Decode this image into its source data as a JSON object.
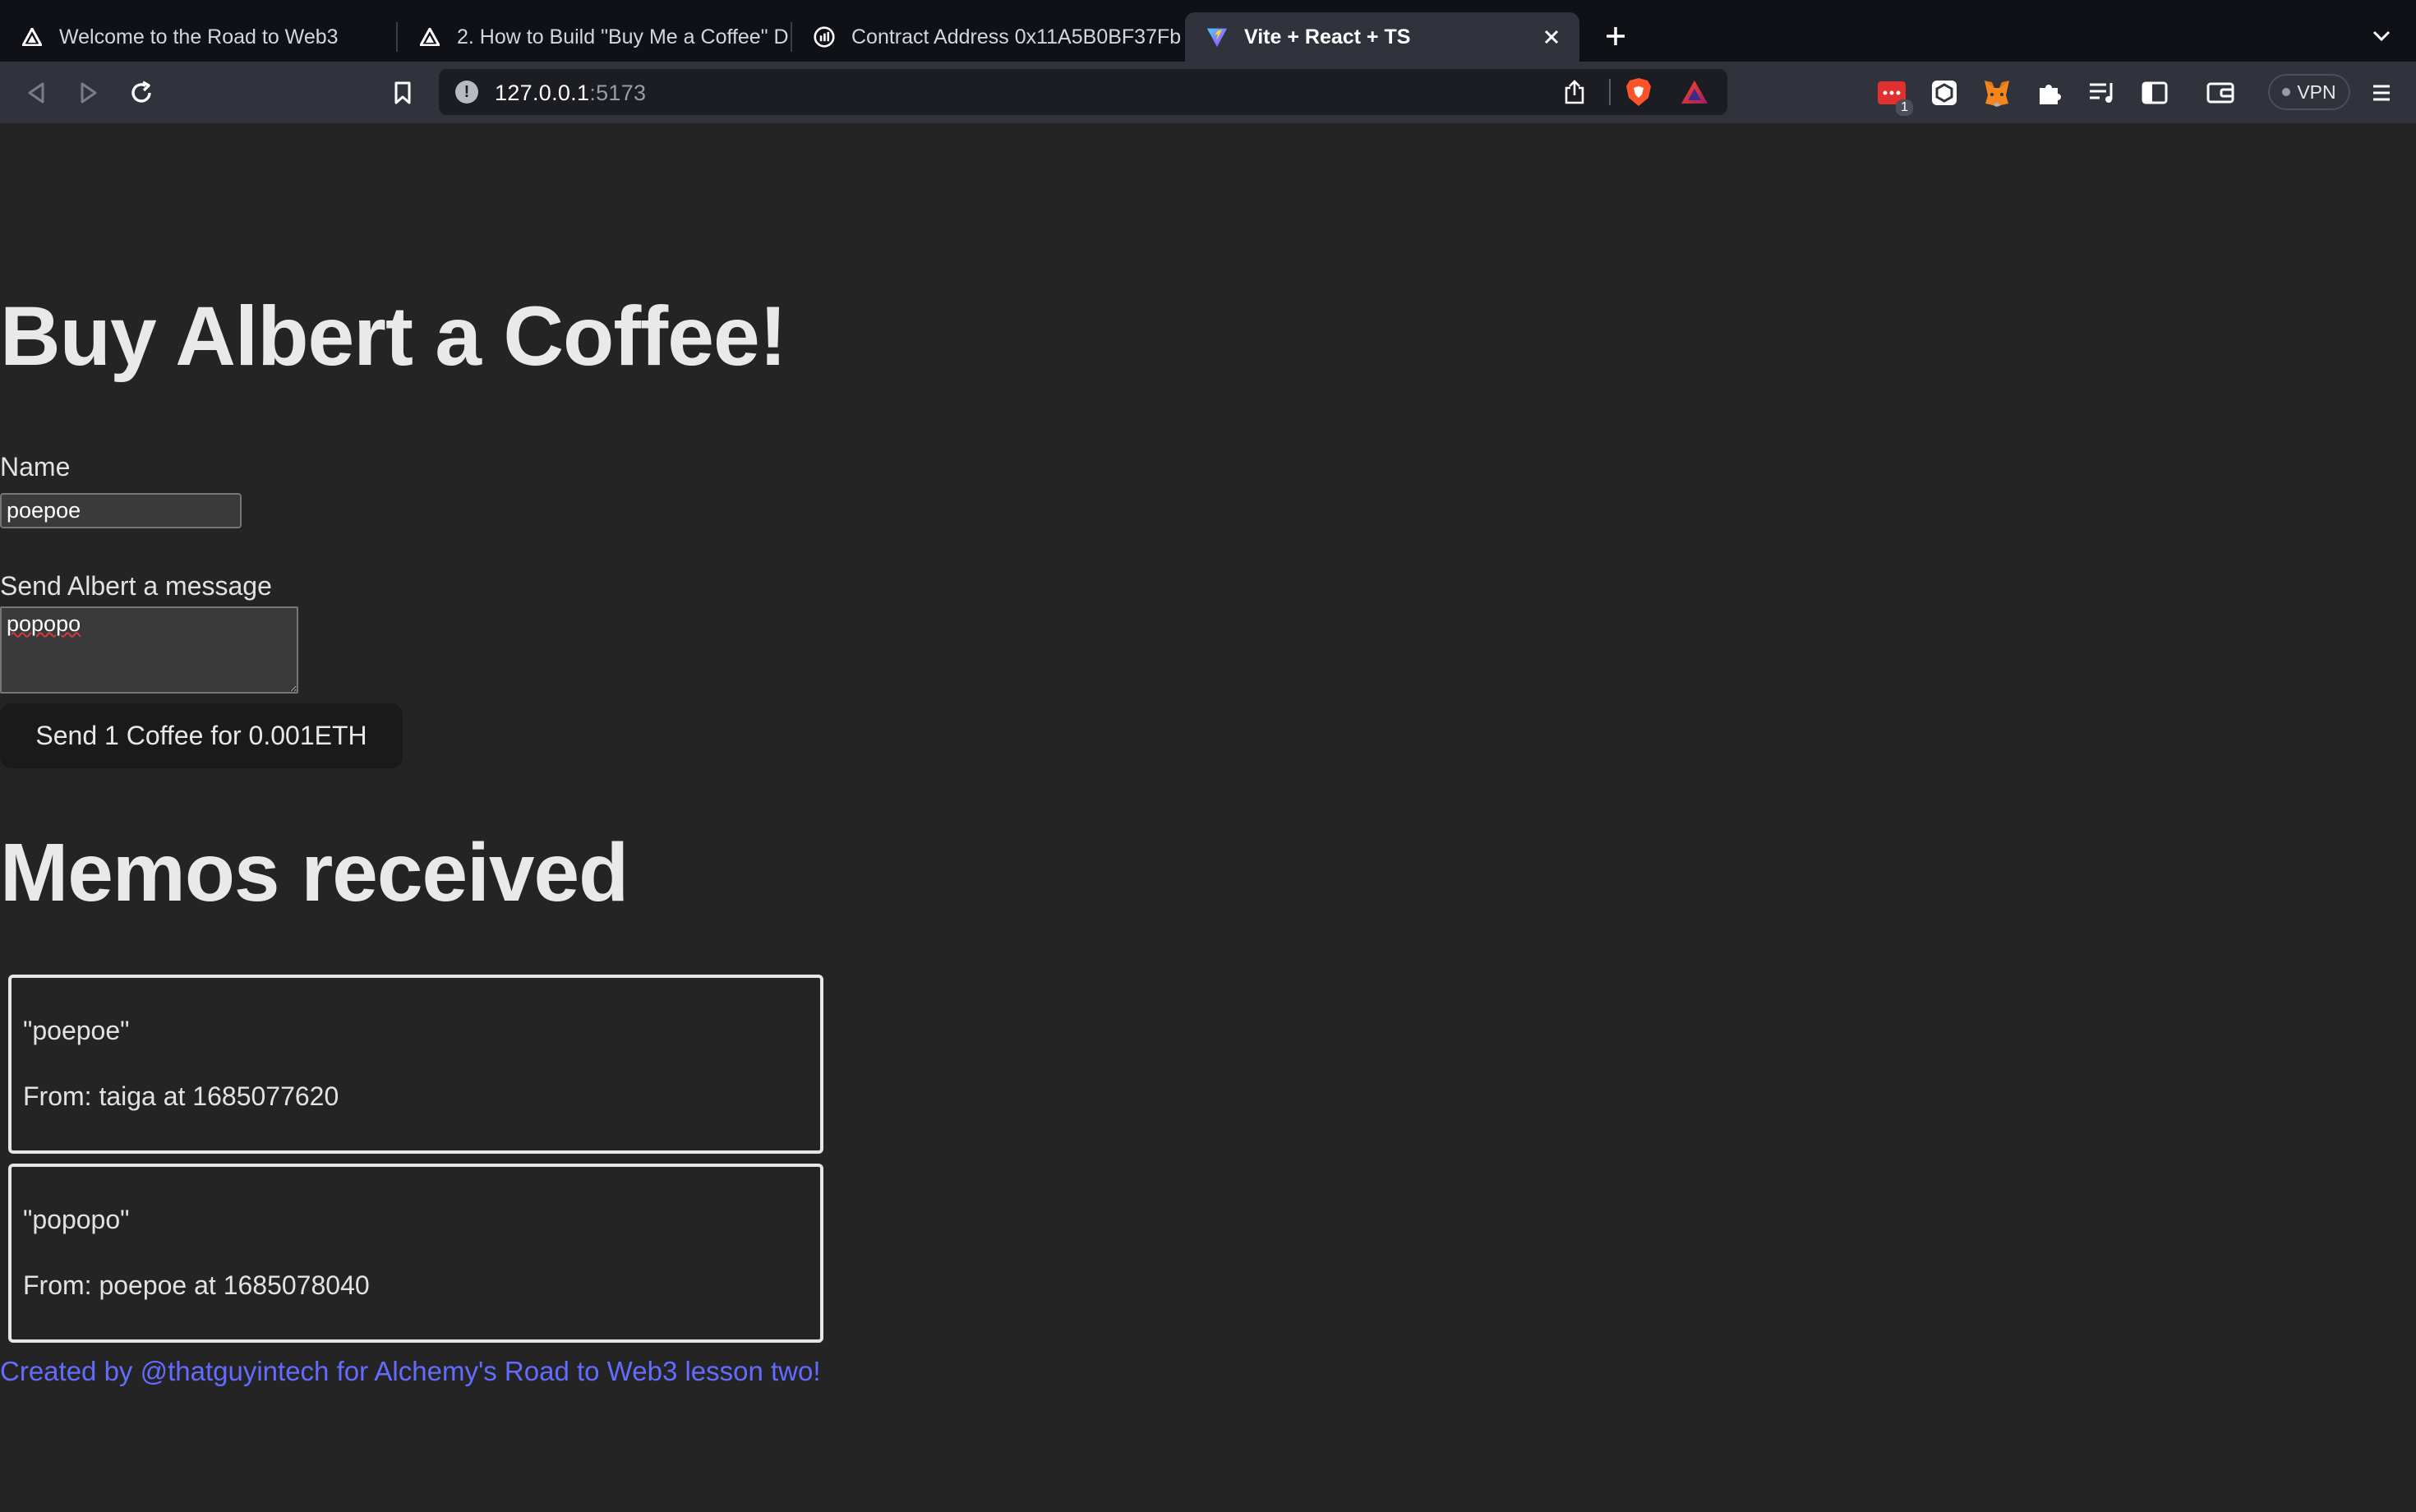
{
  "browser": {
    "tabs": [
      {
        "title": "Welcome to the Road to Web3",
        "icon": "alchemy-icon"
      },
      {
        "title": "2. How to Build \"Buy Me a Coffee\" D",
        "icon": "alchemy-icon"
      },
      {
        "title": "Contract Address 0x11A5B0BF37Fb",
        "icon": "etherscan-icon"
      },
      {
        "title": "Vite + React + TS",
        "icon": "vite-icon",
        "active": true
      }
    ],
    "url_host": "127.0.0.1",
    "url_port": ":5173",
    "extension_badge": "1",
    "vpn_label": "VPN"
  },
  "page": {
    "title": "Buy Albert a Coffee!",
    "name_label": "Name",
    "name_value": "poepoe",
    "message_label": "Send Albert a message",
    "message_value": "popopo",
    "send_button": "Send 1 Coffee for 0.001ETH",
    "memos_title": "Memos received",
    "memos": [
      {
        "message": "\"poepoe\"",
        "from": "From: taiga at 1685077620"
      },
      {
        "message": "\"popopo\"",
        "from": "From: poepoe at 1685078040"
      }
    ],
    "footer": "Created by @thatguyintech for Alchemy's Road to Web3 lesson two!"
  },
  "colors": {
    "page_bg": "#242424",
    "link": "#646cff",
    "tabstrip_bg": "#0f1117",
    "toolbar_bg": "#30333b"
  }
}
